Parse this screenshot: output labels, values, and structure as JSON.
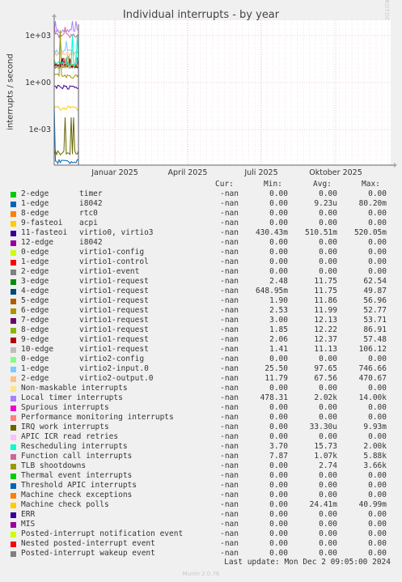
{
  "title": "Individual interrupts - by year",
  "watermark": "RRDTOOL / TOBI OETIKER",
  "footer": "Last update: Mon Dec  2 09:05:00 2024",
  "munin_version": "Munin 2.0.76",
  "legend_headers": {
    "cur": "Cur:",
    "min": "Min:",
    "avg": "Avg:",
    "max": "Max:"
  },
  "chart_data": {
    "type": "line",
    "title": "Individual interrupts - by year",
    "ylabel": "interrupts / second",
    "y_scale": "log",
    "y_ticks": [
      "1e+03",
      "1e+00",
      "1e-03"
    ],
    "x_ticks": [
      "Januar 2025",
      "April 2025",
      "Juli 2025",
      "Oktober 2025"
    ],
    "grid": true,
    "series_end": "Dec 2 2024"
  },
  "series": [
    {
      "name": "2-edge",
      "dev": "timer",
      "color": "#00cc00",
      "cur": "-nan",
      "min": "0.00",
      "avg": "0.00",
      "max": "0.00"
    },
    {
      "name": "1-edge",
      "dev": "i8042",
      "color": "#0066b3",
      "cur": "-nan",
      "min": "0.00",
      "avg": "9.23u",
      "max": "80.20m"
    },
    {
      "name": "8-edge",
      "dev": "rtc0",
      "color": "#ff8000",
      "cur": "-nan",
      "min": "0.00",
      "avg": "0.00",
      "max": "0.00"
    },
    {
      "name": "9-fasteoi",
      "dev": "acpi",
      "color": "#ffcc00",
      "cur": "-nan",
      "min": "0.00",
      "avg": "0.00",
      "max": "0.00"
    },
    {
      "name": "11-fasteoi",
      "dev": "virtio0, virtio3",
      "color": "#330099",
      "cur": "-nan",
      "min": "430.43m",
      "avg": "510.51m",
      "max": "520.05m"
    },
    {
      "name": "12-edge",
      "dev": "i8042",
      "color": "#990099",
      "cur": "-nan",
      "min": "0.00",
      "avg": "0.00",
      "max": "0.00"
    },
    {
      "name": "0-edge",
      "dev": "virtio1-config",
      "color": "#ccff00",
      "cur": "-nan",
      "min": "0.00",
      "avg": "0.00",
      "max": "0.00"
    },
    {
      "name": "1-edge",
      "dev": "virtio1-control",
      "color": "#ff0000",
      "cur": "-nan",
      "min": "0.00",
      "avg": "0.00",
      "max": "0.00"
    },
    {
      "name": "2-edge",
      "dev": "virtio1-event",
      "color": "#808080",
      "cur": "-nan",
      "min": "0.00",
      "avg": "0.00",
      "max": "0.00"
    },
    {
      "name": "3-edge",
      "dev": "virtio1-request",
      "color": "#008f00",
      "cur": "-nan",
      "min": "2.48",
      "avg": "11.75",
      "max": "62.54"
    },
    {
      "name": "4-edge",
      "dev": "virtio1-request",
      "color": "#00487d",
      "cur": "-nan",
      "min": "648.95m",
      "avg": "11.75",
      "max": "49.87"
    },
    {
      "name": "5-edge",
      "dev": "virtio1-request",
      "color": "#b35a00",
      "cur": "-nan",
      "min": "1.90",
      "avg": "11.86",
      "max": "56.96"
    },
    {
      "name": "6-edge",
      "dev": "virtio1-request",
      "color": "#b38f00",
      "cur": "-nan",
      "min": "2.53",
      "avg": "11.99",
      "max": "52.77"
    },
    {
      "name": "7-edge",
      "dev": "virtio1-request",
      "color": "#6b006b",
      "cur": "-nan",
      "min": "3.00",
      "avg": "12.13",
      "max": "53.71"
    },
    {
      "name": "8-edge",
      "dev": "virtio1-request",
      "color": "#8fb300",
      "cur": "-nan",
      "min": "1.85",
      "avg": "12.22",
      "max": "86.91"
    },
    {
      "name": "9-edge",
      "dev": "virtio1-request",
      "color": "#b30000",
      "cur": "-nan",
      "min": "2.06",
      "avg": "12.37",
      "max": "57.48"
    },
    {
      "name": "10-edge",
      "dev": "virtio1-request",
      "color": "#bebebe",
      "cur": "-nan",
      "min": "1.41",
      "avg": "11.13",
      "max": "106.12"
    },
    {
      "name": "0-edge",
      "dev": "virtio2-config",
      "color": "#80ff80",
      "cur": "-nan",
      "min": "0.00",
      "avg": "0.00",
      "max": "0.00"
    },
    {
      "name": "1-edge",
      "dev": "virtio2-input.0",
      "color": "#80c9ff",
      "cur": "-nan",
      "min": "25.50",
      "avg": "97.65",
      "max": "746.66"
    },
    {
      "name": "2-edge",
      "dev": "virtio2-output.0",
      "color": "#ffc080",
      "cur": "-nan",
      "min": "11.79",
      "avg": "67.56",
      "max": "470.67"
    },
    {
      "name": "Non-maskable interrupts",
      "dev": "",
      "color": "#ffe680",
      "cur": "-nan",
      "min": "0.00",
      "avg": "0.00",
      "max": "0.00"
    },
    {
      "name": "Local timer interrupts",
      "dev": "",
      "color": "#aa80ff",
      "cur": "-nan",
      "min": "478.31",
      "avg": "2.02k",
      "max": "14.00k"
    },
    {
      "name": "Spurious interrupts",
      "dev": "",
      "color": "#ee00cc",
      "cur": "-nan",
      "min": "0.00",
      "avg": "0.00",
      "max": "0.00"
    },
    {
      "name": "Performance monitoring interrupts",
      "dev": "",
      "color": "#ff8080",
      "cur": "-nan",
      "min": "0.00",
      "avg": "0.00",
      "max": "0.00"
    },
    {
      "name": "IRQ work interrupts",
      "dev": "",
      "color": "#666600",
      "cur": "-nan",
      "min": "0.00",
      "avg": "33.30u",
      "max": "9.93m"
    },
    {
      "name": "APIC ICR read retries",
      "dev": "",
      "color": "#ffbfff",
      "cur": "-nan",
      "min": "0.00",
      "avg": "0.00",
      "max": "0.00"
    },
    {
      "name": "Rescheduling interrupts",
      "dev": "",
      "color": "#00ffcc",
      "cur": "-nan",
      "min": "3.70",
      "avg": "15.73",
      "max": "2.00k"
    },
    {
      "name": "Function call interrupts",
      "dev": "",
      "color": "#cc6699",
      "cur": "-nan",
      "min": "7.87",
      "avg": "1.07k",
      "max": "5.88k"
    },
    {
      "name": "TLB shootdowns",
      "dev": "",
      "color": "#999900",
      "cur": "-nan",
      "min": "0.00",
      "avg": "2.74",
      "max": "3.66k"
    },
    {
      "name": "Thermal event interrupts",
      "dev": "",
      "color": "#00cc00",
      "cur": "-nan",
      "min": "0.00",
      "avg": "0.00",
      "max": "0.00"
    },
    {
      "name": "Threshold APIC interrupts",
      "dev": "",
      "color": "#0066b3",
      "cur": "-nan",
      "min": "0.00",
      "avg": "0.00",
      "max": "0.00"
    },
    {
      "name": "Machine check exceptions",
      "dev": "",
      "color": "#ff8000",
      "cur": "-nan",
      "min": "0.00",
      "avg": "0.00",
      "max": "0.00"
    },
    {
      "name": "Machine check polls",
      "dev": "",
      "color": "#ffcc00",
      "cur": "-nan",
      "min": "0.00",
      "avg": "24.41m",
      "max": "40.99m"
    },
    {
      "name": "ERR",
      "dev": "",
      "color": "#330099",
      "cur": "-nan",
      "min": "0.00",
      "avg": "0.00",
      "max": "0.00"
    },
    {
      "name": "MIS",
      "dev": "",
      "color": "#990099",
      "cur": "-nan",
      "min": "0.00",
      "avg": "0.00",
      "max": "0.00"
    },
    {
      "name": "Posted-interrupt notification event",
      "dev": "",
      "color": "#ccff00",
      "cur": "-nan",
      "min": "0.00",
      "avg": "0.00",
      "max": "0.00"
    },
    {
      "name": "Nested posted-interrupt event",
      "dev": "",
      "color": "#ff0000",
      "cur": "-nan",
      "min": "0.00",
      "avg": "0.00",
      "max": "0.00"
    },
    {
      "name": "Posted-interrupt wakeup event",
      "dev": "",
      "color": "#808080",
      "cur": "-nan",
      "min": "0.00",
      "avg": "0.00",
      "max": "0.00"
    }
  ]
}
